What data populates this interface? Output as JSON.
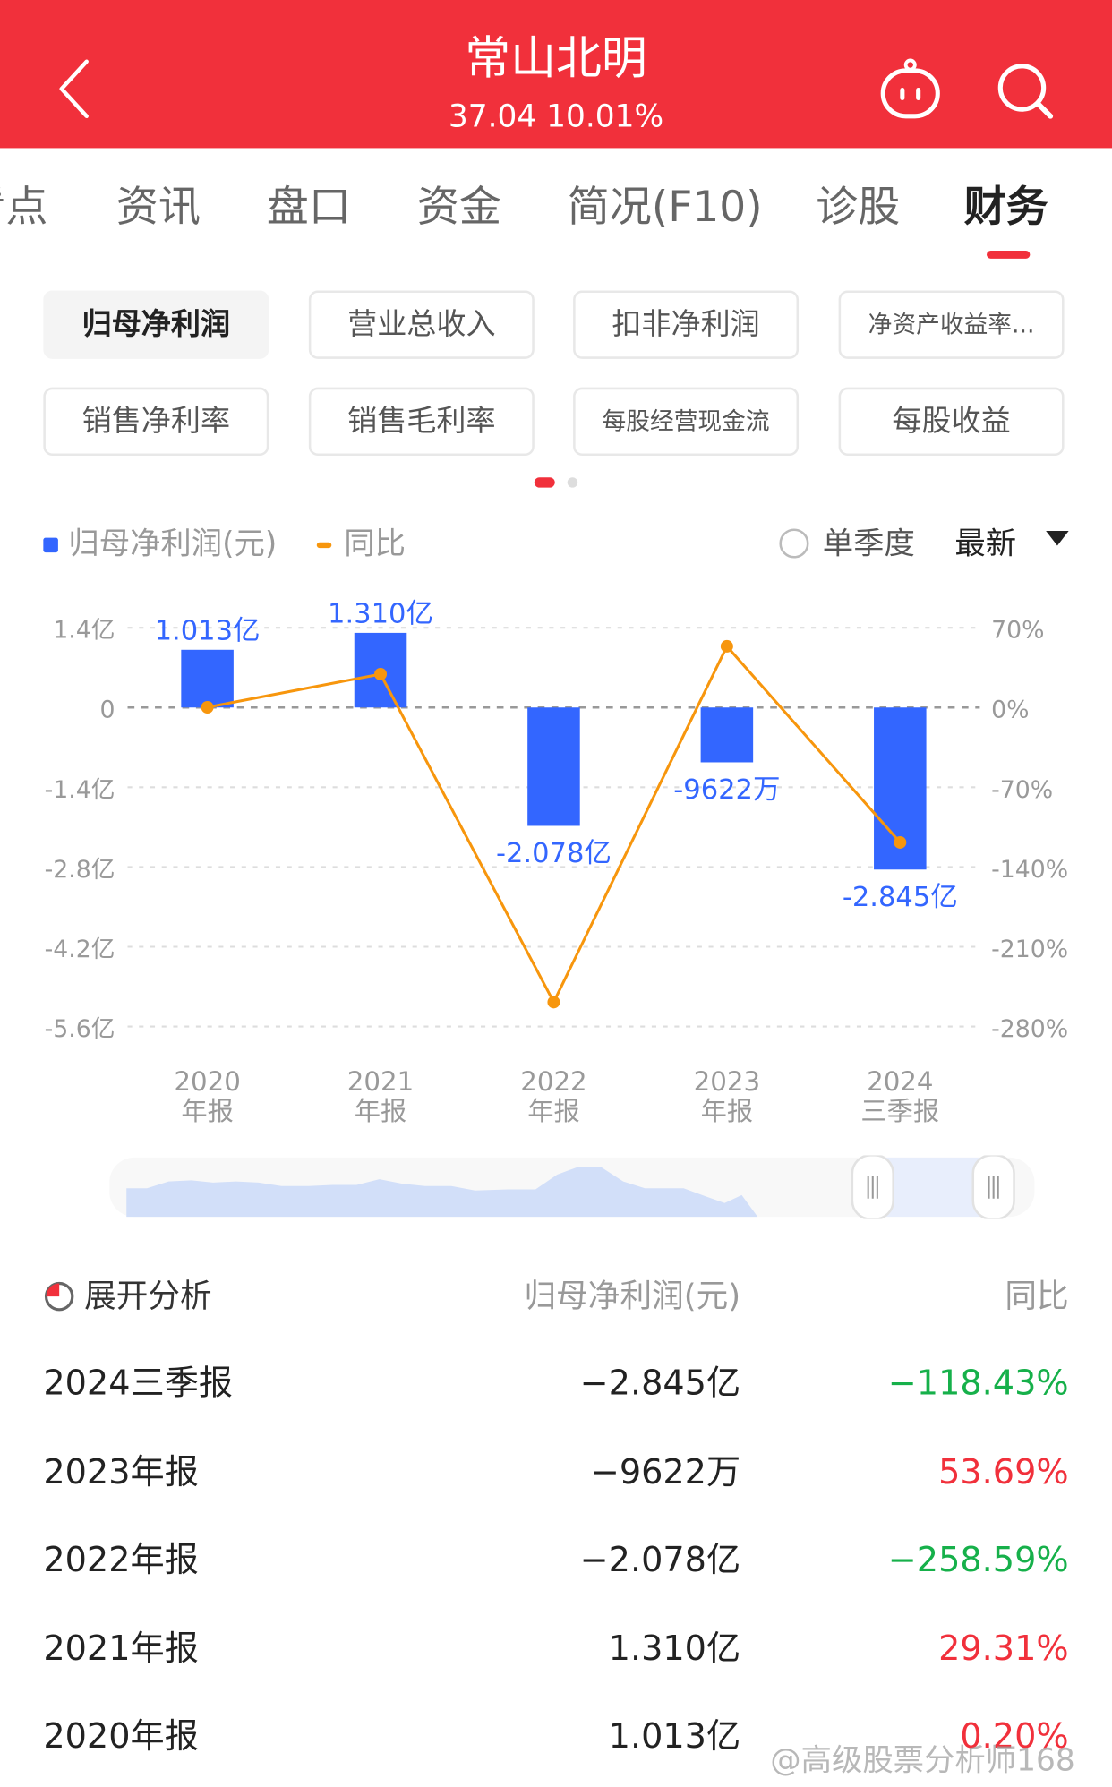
{
  "header": {
    "title": "常山北明",
    "price": "37.04",
    "change_pct": "10.01%",
    "subtitle": "37.04 10.01%",
    "icons": [
      "back-arrow-icon",
      "robot-assistant-icon",
      "search-icon"
    ]
  },
  "tabs": [
    {
      "label": "看点",
      "visible_text": "看点",
      "active": false
    },
    {
      "label": "资讯",
      "active": false
    },
    {
      "label": "盘口",
      "active": false
    },
    {
      "label": "资金",
      "active": false
    },
    {
      "label": "简况(F10)",
      "active": false
    },
    {
      "label": "诊股",
      "active": false
    },
    {
      "label": "财务",
      "active": true
    }
  ],
  "metric_chips": [
    {
      "label": "归母净利润",
      "active": true
    },
    {
      "label": "营业总收入",
      "active": false
    },
    {
      "label": "扣非净利润",
      "active": false
    },
    {
      "label": "净资产收益率...",
      "active": false
    },
    {
      "label": "销售净利率",
      "active": false
    },
    {
      "label": "销售毛利率",
      "active": false
    },
    {
      "label": "每股经营现金流",
      "active": false
    },
    {
      "label": "每股收益",
      "active": false
    }
  ],
  "pager": {
    "pages": 2,
    "current": 1
  },
  "legend": {
    "bar_label": "归母净利润(元)",
    "line_label": "同比",
    "single_quarter_label": "单季度",
    "single_quarter_checked": false,
    "sort_label": "最新"
  },
  "colors": {
    "brand_red": "#f1303b",
    "bar_blue": "#3366ff",
    "line_orange": "#f7960d",
    "up_red": "#f1303b",
    "down_green": "#16b04a"
  },
  "chart_data": {
    "type": "bar",
    "title": "",
    "categories": [
      "2020\n年报",
      "2021\n年报",
      "2022\n年报",
      "2023\n年报",
      "2024\n三季报"
    ],
    "category_lines": [
      [
        "2020",
        "年报"
      ],
      [
        "2021",
        "年报"
      ],
      [
        "2022",
        "年报"
      ],
      [
        "2023",
        "年报"
      ],
      [
        "2024",
        "三季报"
      ]
    ],
    "series": [
      {
        "name": "归母净利润(元)",
        "type": "bar",
        "axis": "left",
        "unit": "亿",
        "values": [
          1.013,
          1.31,
          -2.078,
          -0.9622,
          -2.845
        ],
        "labels": [
          "1.013亿",
          "1.310亿",
          "-2.078亿",
          "-9622万",
          "-2.845亿"
        ]
      },
      {
        "name": "同比",
        "type": "line",
        "axis": "right",
        "unit": "%",
        "values": [
          0.2,
          29.31,
          -258.59,
          53.69,
          -118.43
        ]
      }
    ],
    "left_axis": {
      "ylim": [
        -5.6,
        1.4
      ],
      "ticks": [
        1.4,
        0,
        -1.4,
        -2.8,
        -4.2,
        -5.6
      ],
      "tick_labels": [
        "1.4亿",
        "0",
        "-1.4亿",
        "-2.8亿",
        "-4.2亿",
        "-5.6亿"
      ]
    },
    "right_axis": {
      "ylim": [
        -280,
        70
      ],
      "ticks": [
        70,
        0,
        -70,
        -140,
        -210,
        -280
      ],
      "tick_labels": [
        "70%",
        "0%",
        "-70%",
        "-140%",
        "-210%",
        "-280%"
      ]
    },
    "grid": true,
    "legend_position": "top-left"
  },
  "range_slider": {
    "start_fraction": 0.83,
    "end_fraction": 1.0
  },
  "table": {
    "expand_label": "展开分析",
    "col_value": "归母净利润(元)",
    "col_yoy": "同比",
    "rows": [
      {
        "period": "2024三季报",
        "value": "−2.845亿",
        "yoy": "−118.43%",
        "trend": "down"
      },
      {
        "period": "2023年报",
        "value": "−9622万",
        "yoy": "53.69%",
        "trend": "up"
      },
      {
        "period": "2022年报",
        "value": "−2.078亿",
        "yoy": "−258.59%",
        "trend": "down"
      },
      {
        "period": "2021年报",
        "value": "1.310亿",
        "yoy": "29.31%",
        "trend": "up"
      },
      {
        "period": "2020年报",
        "value": "1.013亿",
        "yoy": "0.20%",
        "trend": "up"
      }
    ]
  },
  "watermark": "@高级股票分析师168"
}
